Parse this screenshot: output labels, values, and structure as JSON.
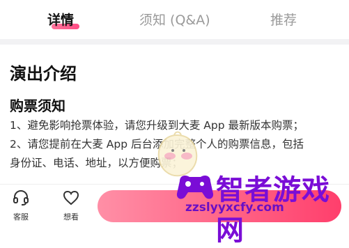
{
  "tabs": [
    {
      "label": "详情",
      "active": true
    },
    {
      "label": "须知 (Q&A)",
      "active": false
    },
    {
      "label": "推荐",
      "active": false
    }
  ],
  "content": {
    "section_title": "演出介绍",
    "sub_title": "购票须知",
    "lines": [
      "1、避免影响抢票体验，请您升级到大麦 App 最新版本购票；",
      "2、请您提前在大麦 App 后台添加完整个人的购票信息，包括",
      "身份证、电话、地址，以方便购票；"
    ]
  },
  "bottom_bar": {
    "customer_service_label": "客服",
    "want_to_see_label": "想看",
    "buy_button_label": ""
  },
  "watermark": {
    "brand": "智者游戏网",
    "url": "zzslyyxcfy.com"
  },
  "colors": {
    "accent": "#ff3f6c",
    "watermark": "#7a0dd6"
  }
}
